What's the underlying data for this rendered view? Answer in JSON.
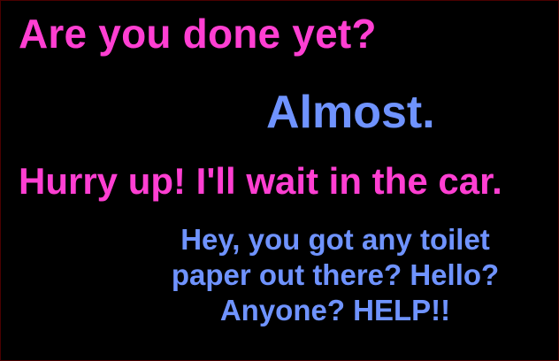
{
  "dialogue": {
    "line1": "Are you done yet?",
    "line2": "Almost.",
    "line3": "Hurry up! I'll wait in the car.",
    "line4": {
      "row1": "Hey, you got any toilet",
      "row2": "paper out there? Hello?",
      "row3": "Anyone? HELP!!"
    }
  },
  "colors": {
    "background": "#000000",
    "speaker_a": "#ff3fd2",
    "speaker_b": "#6f93ff"
  }
}
